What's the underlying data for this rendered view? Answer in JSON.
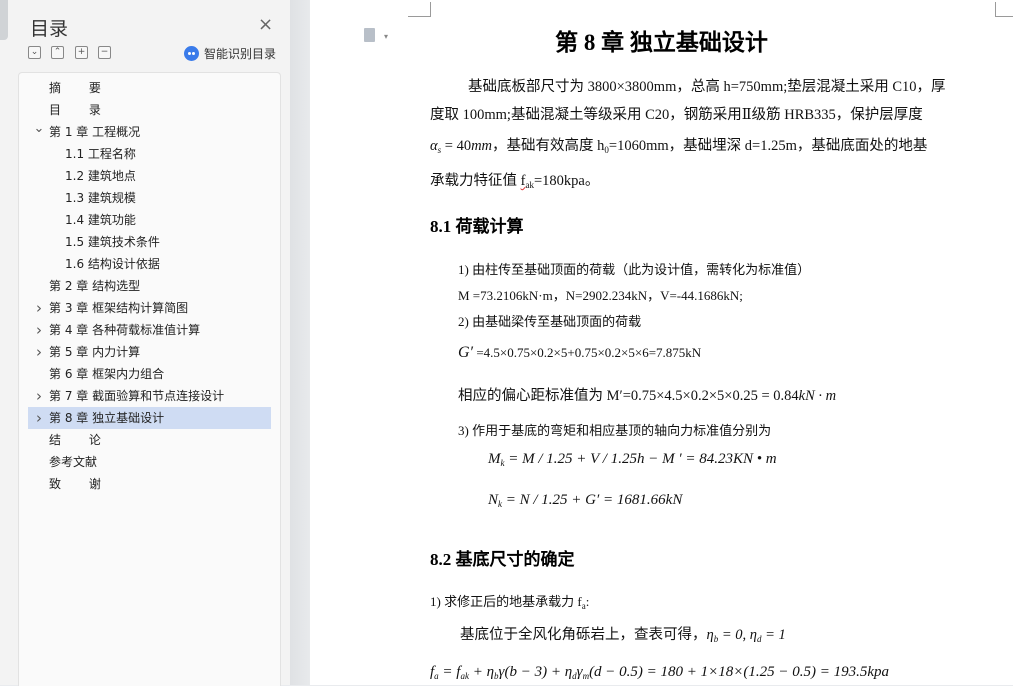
{
  "nav": {
    "title": "目录",
    "close_glyph": "×",
    "tool_buttons": [
      "⌄",
      "⌃",
      "+",
      "−"
    ],
    "smart_label": "智能识别目录",
    "items": [
      {
        "label": "摘 要",
        "level": 1,
        "chevron": "none",
        "spaced": true
      },
      {
        "label": "目 录",
        "level": 1,
        "chevron": "none",
        "spaced": true
      },
      {
        "label": "第 1 章 工程概况",
        "level": 1,
        "chevron": "down"
      },
      {
        "label": "1.1 工程名称",
        "level": 2,
        "chevron": "none"
      },
      {
        "label": "1.2 建筑地点",
        "level": 2,
        "chevron": "none"
      },
      {
        "label": "1.3 建筑规模",
        "level": 2,
        "chevron": "none"
      },
      {
        "label": "1.4 建筑功能",
        "level": 2,
        "chevron": "none"
      },
      {
        "label": "1.5 建筑技术条件",
        "level": 2,
        "chevron": "none"
      },
      {
        "label": "1.6 结构设计依据",
        "level": 2,
        "chevron": "none"
      },
      {
        "label": "第 2 章 结构选型",
        "level": 1,
        "chevron": "none"
      },
      {
        "label": "第 3 章 框架结构计算简图",
        "level": 1,
        "chevron": "right"
      },
      {
        "label": "第 4 章 各种荷载标准值计算",
        "level": 1,
        "chevron": "right"
      },
      {
        "label": "第 5 章 内力计算",
        "level": 1,
        "chevron": "right"
      },
      {
        "label": "第 6 章 框架内力组合",
        "level": 1,
        "chevron": "none"
      },
      {
        "label": "第 7 章 截面验算和节点连接设计",
        "level": 1,
        "chevron": "right"
      },
      {
        "label": "第 8 章 独立基础设计",
        "level": 1,
        "chevron": "right",
        "selected": true
      },
      {
        "label": "结 论",
        "level": 1,
        "chevron": "none",
        "spaced": true
      },
      {
        "label": "参考文献",
        "level": 1,
        "chevron": "none"
      },
      {
        "label": "致 谢",
        "level": 1,
        "chevron": "none",
        "spaced": true
      }
    ]
  },
  "doc": {
    "chapter_title": "第 8 章  独立基础设计",
    "intro": {
      "line1": "基础底板部尺寸为 3800×3800mm，总高 h=750mm;垫层混凝土采用 C10，厚",
      "line2": "度取 100mm;基础混凝土等级采用 C20，钢筋采用Ⅱ级筋 HRB335，保护层厚度",
      "line3_alpha": "α",
      "line3_alpha_sub": "s",
      "line3_eq": " = 40",
      "line3_unit": "mm",
      "line3_rest": "，基础有效高度 h",
      "line3_h0_sub": "0",
      "line3_rest2": "=1060mm，基础埋深 d=1.25m，基础底面处的地基",
      "line4_pre": "承载力特征值 ",
      "line4_fak": "f",
      "line4_fak_sub": "ak",
      "line4_post": "=180kpa。"
    },
    "sec81": {
      "title": "8.1 荷载计算",
      "item1": "1)  由柱传至基础顶面的荷载（此为设计值，需转化为标准值）",
      "loads": "M =73.2106kN·m，N=2902.234kN，V=-44.1686kN;",
      "item2": "2)  由基础梁传至基础顶面的荷载",
      "g_sym": "G′",
      "g_expr": " =4.5×0.75×0.2×5+0.75×0.2×5×6=7.875kN",
      "ecc_pre": "相应的偏心距标准值为 ",
      "ecc_expr": "M′=0.75×4.5×0.2×5×0.25 = 0.84",
      "ecc_unit": "kN · m",
      "item3": "3)  作用于基底的弯矩和相应基顶的轴向力标准值分别为",
      "mk_expr": "M",
      "mk_sub": "k",
      "mk_rest": " = M / 1.25 + V / 1.25h − M ′ = 84.23KN • m",
      "nk_expr": "N",
      "nk_sub": "k",
      "nk_rest": " = N / 1.25 + G′ = 1681.66kN"
    },
    "sec82": {
      "title": "8.2 基底尺寸的确定",
      "item1_pre": "1)  求修正后的地基承载力 ",
      "item1_f": "f",
      "item1_sub": "a",
      "item1_post": ":",
      "soil_pre": "基底位于全风化角砾岩上，查表可得，",
      "soil_eq": "η",
      "soil_b": "b",
      "soil_mid": " = 0, η",
      "soil_d": "d",
      "soil_end": " = 1",
      "fa_f": "f",
      "fa_sub": "a",
      "fa_rest": " = f",
      "fa_ak": "ak",
      "fa_rest2": " + η",
      "fa_b": "b",
      "fa_rest3": "γ(b − 3) + η",
      "fa_d": "d",
      "fa_rest4": "γ",
      "fa_m": "m",
      "fa_rest5": "(d − 0.5) = 180 + 1×18×(1.25 − 0.5) = 193.5kpa"
    }
  }
}
